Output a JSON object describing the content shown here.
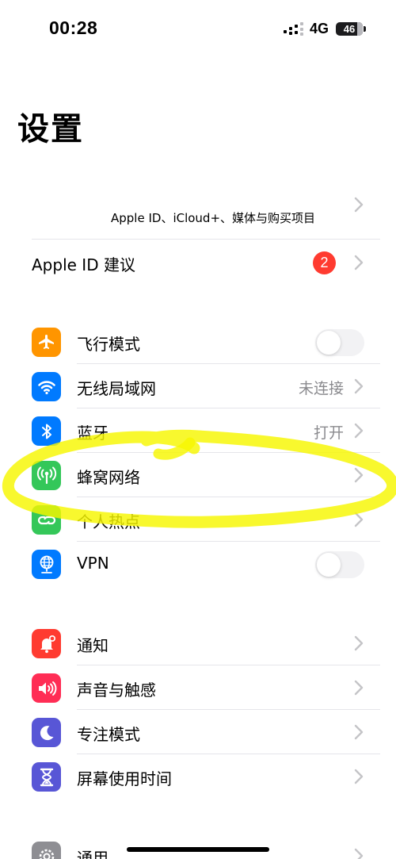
{
  "status_bar": {
    "time": "00:28",
    "network": "4G",
    "battery": "46"
  },
  "page": {
    "title": "设置"
  },
  "account": {
    "subtitle": "Apple ID、iCloud+、媒体与购买项目",
    "suggestions_label": "Apple ID 建议",
    "suggestions_badge": "2"
  },
  "connectivity": [
    {
      "label": "飞行模式",
      "value": "",
      "icon": "airplane-icon",
      "color": "#ff9500",
      "toggle": "off"
    },
    {
      "label": "无线局域网",
      "value": "未连接",
      "icon": "wifi-icon",
      "color": "#007aff"
    },
    {
      "label": "蓝牙",
      "value": "打开",
      "icon": "bluetooth-icon",
      "color": "#007aff"
    },
    {
      "label": "蜂窝网络",
      "value": "",
      "icon": "cellular-icon",
      "color": "#34c759"
    },
    {
      "label": "个人热点",
      "value": "",
      "icon": "hotspot-icon",
      "color": "#34c759"
    },
    {
      "label": "VPN",
      "value": "",
      "icon": "vpn-globe-icon",
      "color": "#007aff",
      "toggle": "off"
    }
  ],
  "notifications": [
    {
      "label": "通知",
      "icon": "notification-bell-icon",
      "color": "#ff3b30"
    },
    {
      "label": "声音与触感",
      "icon": "speaker-icon",
      "color": "#ff2d55"
    },
    {
      "label": "专注模式",
      "icon": "moon-icon",
      "color": "#5856d6"
    },
    {
      "label": "屏幕使用时间",
      "icon": "hourglass-icon",
      "color": "#5856d6"
    }
  ],
  "general": [
    {
      "label": "通用",
      "icon": "gear-icon",
      "color": "#8e8e93"
    }
  ],
  "annotation": {
    "color": "#f7f700"
  }
}
